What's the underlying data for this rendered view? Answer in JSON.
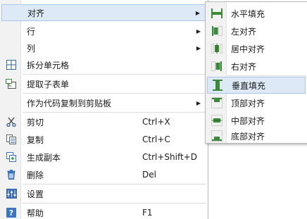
{
  "main_menu": {
    "items": [
      {
        "label": "对齐",
        "icon": "none",
        "submenu": true
      },
      {
        "label": "行",
        "icon": "none",
        "submenu": true
      },
      {
        "label": "列",
        "icon": "none",
        "submenu": true
      },
      {
        "label": "拆分单元格",
        "icon": "grid-split-icon"
      },
      {
        "label": "提取子表单",
        "icon": "extract-subform-icon"
      },
      {
        "label": "作为代码复制到剪贴板",
        "icon": "none",
        "submenu": true
      },
      {
        "label": "剪切",
        "icon": "cut-icon",
        "shortcut": "Ctrl+X"
      },
      {
        "label": "复制",
        "icon": "copy-icon",
        "shortcut": "Ctrl+C"
      },
      {
        "label": "生成副本",
        "icon": "duplicate-icon",
        "shortcut": "Ctrl+Shift+D"
      },
      {
        "label": "删除",
        "icon": "delete-icon",
        "shortcut": "Del"
      },
      {
        "label": "设置",
        "icon": "settings-icon"
      },
      {
        "label": "帮助",
        "icon": "help-icon",
        "shortcut": "F1"
      }
    ]
  },
  "sub_menu": {
    "items": [
      {
        "label": "水平填充",
        "icon": "fill-horizontal-icon"
      },
      {
        "label": "左对齐",
        "icon": "align-left-icon"
      },
      {
        "label": "居中对齐",
        "icon": "align-center-icon"
      },
      {
        "label": "右对齐",
        "icon": "align-right-icon"
      },
      {
        "label": "垂直填充",
        "icon": "fill-vertical-icon"
      },
      {
        "label": "顶部对齐",
        "icon": "align-top-icon"
      },
      {
        "label": "中部对齐",
        "icon": "align-middle-icon"
      },
      {
        "label": "底部对齐",
        "icon": "align-bottom-icon"
      }
    ]
  },
  "colors": {
    "highlight": "#dde9f6",
    "highlight_border": "#a9c6e7",
    "icon_green": "#3a8a3a",
    "icon_blue": "#3a74c4"
  }
}
